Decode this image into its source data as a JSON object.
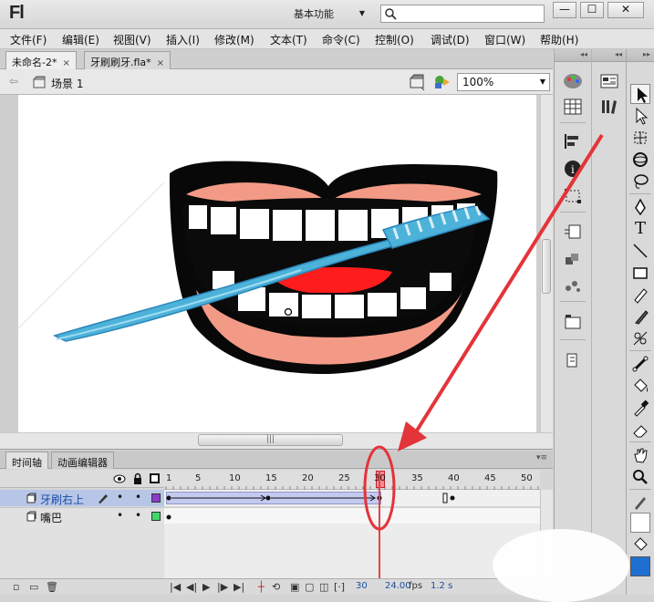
{
  "app": {
    "logo": "Fl",
    "workspace": "基本功能",
    "search_placeholder": ""
  },
  "window_buttons": [
    "—",
    "☐",
    "✕"
  ],
  "menu": [
    "文件(F)",
    "编辑(E)",
    "视图(V)",
    "插入(I)",
    "修改(M)",
    "文本(T)",
    "命令(C)",
    "控制(O)",
    "调试(D)",
    "窗口(W)",
    "帮助(H)"
  ],
  "doc_tabs": [
    {
      "label": "未命名-2*",
      "close": "×",
      "active": true
    },
    {
      "label": "牙刷刷牙.fla*",
      "close": "×",
      "active": false
    }
  ],
  "scene": {
    "label": "场景 1"
  },
  "zoom": {
    "value": "100%"
  },
  "timeline": {
    "tabs": [
      "时间轴",
      "动画编辑器"
    ],
    "ruler": [
      "1",
      "5",
      "10",
      "15",
      "20",
      "25",
      "30",
      "35",
      "40",
      "45",
      "50"
    ],
    "current_frame_marker": "30",
    "layers": [
      {
        "name": "牙刷右上",
        "selected": true,
        "color": "#8b3cc4"
      },
      {
        "name": "嘴巴",
        "selected": false,
        "color": "#3fd66a"
      }
    ],
    "status": {
      "frame": "30",
      "fps": "24.00",
      "fps_unit": "fps",
      "time": "1.2 s"
    }
  },
  "colors": {
    "selection": "#b7c6e6",
    "playhead": "#e2434b",
    "annotation": "#e3343a",
    "tween_fill": "#c4c9ef",
    "lip": "#f39a87",
    "toothbrush": "#4db2da"
  }
}
